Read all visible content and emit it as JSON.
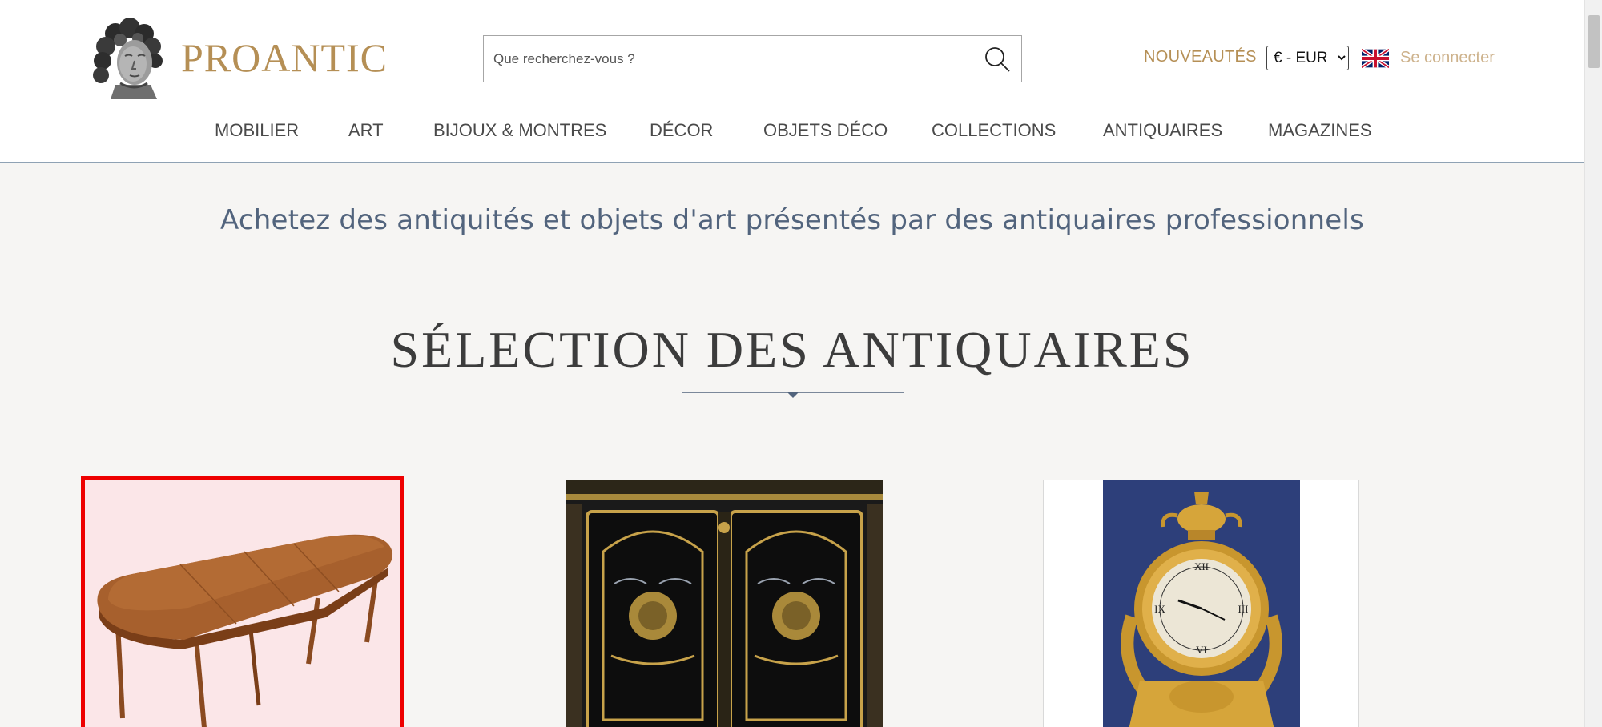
{
  "header": {
    "logo_text": "PROANTIC",
    "search": {
      "placeholder": "Que recherchez-vous ?",
      "value": ""
    },
    "nouveautes_label": "NOUVEAUTÉS",
    "currency": {
      "selected": "€ - EUR"
    },
    "language_flag": "uk-flag-icon",
    "login_label": "Se connecter"
  },
  "nav": {
    "items": [
      {
        "label": "MOBILIER"
      },
      {
        "label": "ART"
      },
      {
        "label": "BIJOUX & MONTRES"
      },
      {
        "label": "DÉCOR"
      },
      {
        "label": "OBJETS DÉCO"
      },
      {
        "label": "COLLECTIONS"
      },
      {
        "label": "ANTIQUAIRES"
      },
      {
        "label": "MAGAZINES"
      }
    ]
  },
  "main": {
    "tagline": "Achetez des antiquités et objets d'art présentés par des antiquaires professionnels",
    "section_title": "SÉLECTION DES ANTIQUAIRES",
    "products": [
      {
        "image": "extendable-dining-table-image",
        "selected": true
      },
      {
        "image": "boulle-cabinet-image",
        "selected": false
      },
      {
        "image": "gilt-bronze-mantel-clock-image",
        "selected": false
      }
    ]
  },
  "colors": {
    "brand_gold": "#b58f55",
    "login_gold": "#cdb28c",
    "tagline_blue": "#52647d",
    "background": "#f6f5f3",
    "selection_red": "#ee0000"
  }
}
